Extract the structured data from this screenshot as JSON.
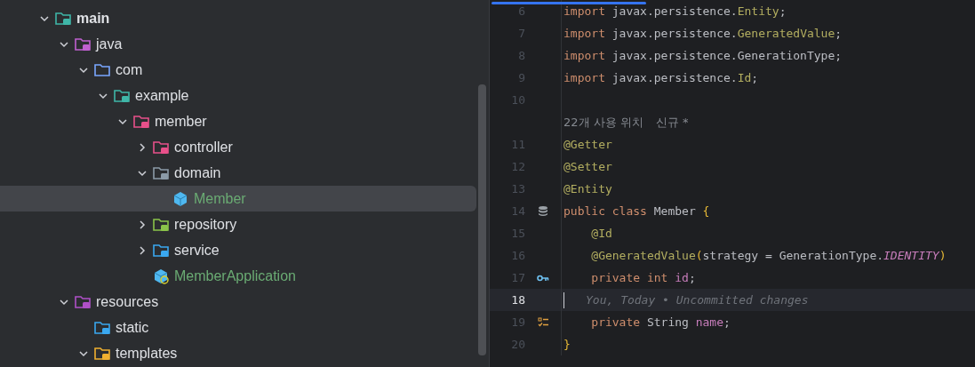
{
  "project_tree": [
    {
      "label": "main",
      "kind": "module",
      "expanded": true,
      "selected": false,
      "color": "#dfe1e5",
      "children": [
        {
          "label": "java",
          "kind": "source",
          "expanded": true,
          "selected": false,
          "color": "#dfe1e5",
          "children": [
            {
              "label": "com",
              "kind": "package",
              "expanded": true,
              "selected": false,
              "color": "#dfe1e5",
              "children": [
                {
                  "label": "example",
                  "kind": "app-package",
                  "expanded": true,
                  "selected": false,
                  "color": "#dfe1e5",
                  "children": [
                    {
                      "label": "member",
                      "kind": "people-package",
                      "expanded": true,
                      "selected": false,
                      "color": "#dfe1e5",
                      "children": [
                        {
                          "label": "controller",
                          "kind": "gear-package",
                          "expanded": false,
                          "selected": false,
                          "color": "#dfe1e5"
                        },
                        {
                          "label": "domain",
                          "kind": "domain-package",
                          "expanded": true,
                          "selected": false,
                          "color": "#dfe1e5",
                          "children": [
                            {
                              "label": "Member",
                              "kind": "class",
                              "selected": true,
                              "color": "#6aab73"
                            }
                          ]
                        },
                        {
                          "label": "repository",
                          "kind": "db-package",
                          "expanded": false,
                          "selected": false,
                          "color": "#dfe1e5"
                        },
                        {
                          "label": "service",
                          "kind": "service-package",
                          "expanded": false,
                          "selected": false,
                          "color": "#dfe1e5"
                        },
                        {
                          "label": "MemberApplication",
                          "kind": "app-class",
                          "selected": false,
                          "color": "#6aab73"
                        }
                      ]
                    }
                  ]
                }
              ]
            }
          ]
        },
        {
          "label": "resources",
          "kind": "resources",
          "expanded": true,
          "selected": false,
          "color": "#dfe1e5",
          "children": [
            {
              "label": "static",
              "kind": "web",
              "selected": false,
              "color": "#dfe1e5"
            },
            {
              "label": "templates",
              "kind": "templates",
              "expanded": true,
              "selected": false,
              "color": "#dfe1e5"
            }
          ]
        }
      ]
    }
  ],
  "editor": {
    "progress": {
      "level": 0.32
    },
    "lines": [
      {
        "kind": "code",
        "number": "6",
        "tokens": [
          {
            "kind": "kw",
            "text": "import "
          },
          {
            "kind": "plain",
            "text": "javax.persistence."
          },
          {
            "kind": "ann",
            "text": "Entity"
          },
          {
            "kind": "plain",
            "text": ";"
          }
        ]
      },
      {
        "kind": "code",
        "number": "7",
        "tokens": [
          {
            "kind": "kw",
            "text": "import "
          },
          {
            "kind": "plain",
            "text": "javax.persistence."
          },
          {
            "kind": "ann",
            "text": "GeneratedValue"
          },
          {
            "kind": "plain",
            "text": ";"
          }
        ]
      },
      {
        "kind": "code",
        "number": "8",
        "tokens": [
          {
            "kind": "kw",
            "text": "import "
          },
          {
            "kind": "plain",
            "text": "javax.persistence.GenerationType;"
          }
        ]
      },
      {
        "kind": "code",
        "number": "9",
        "tokens": [
          {
            "kind": "kw",
            "text": "import "
          },
          {
            "kind": "plain",
            "text": "javax.persistence."
          },
          {
            "kind": "ann",
            "text": "Id"
          },
          {
            "kind": "plain",
            "text": ";"
          }
        ]
      },
      {
        "kind": "code",
        "number": "10"
      },
      {
        "kind": "hint",
        "text": "22개 사용 위치",
        "extra": "신규 *"
      },
      {
        "kind": "code",
        "number": "11",
        "tokens": [
          {
            "kind": "ann",
            "text": "@Getter"
          }
        ]
      },
      {
        "kind": "code",
        "number": "12",
        "tokens": [
          {
            "kind": "ann",
            "text": "@Setter"
          }
        ]
      },
      {
        "kind": "code",
        "number": "13",
        "tokens": [
          {
            "kind": "ann",
            "text": "@Entity"
          }
        ]
      },
      {
        "kind": "code",
        "number": "14",
        "gutter": {
          "kind": "database"
        },
        "tokens": [
          {
            "kind": "kw",
            "text": "public class "
          },
          {
            "kind": "plain",
            "text": "Member "
          },
          {
            "kind": "brace",
            "text": "{"
          }
        ]
      },
      {
        "kind": "code",
        "number": "15",
        "tokens": [
          {
            "kind": "ann",
            "text": "    @Id"
          }
        ]
      },
      {
        "kind": "code",
        "number": "16",
        "tokens": [
          {
            "kind": "ann",
            "text": "    @GeneratedValue"
          },
          {
            "kind": "brace",
            "text": "("
          },
          {
            "kind": "plain",
            "text": "strategy = GenerationType."
          },
          {
            "kind": "const",
            "text": "IDENTITY"
          },
          {
            "kind": "brace",
            "text": ")"
          }
        ]
      },
      {
        "kind": "code",
        "number": "17",
        "gutter": {
          "kind": "key"
        },
        "tokens": [
          {
            "kind": "kw",
            "text": "    private int "
          },
          {
            "kind": "field",
            "text": "id"
          },
          {
            "kind": "plain",
            "text": ";"
          }
        ]
      },
      {
        "kind": "blame",
        "number": "18",
        "current": true,
        "text": "You, Today • Uncommitted changes"
      },
      {
        "kind": "code",
        "number": "19",
        "gutter": {
          "kind": "checklist"
        },
        "tokens": [
          {
            "kind": "kw",
            "text": "    private "
          },
          {
            "kind": "plain",
            "text": "String "
          },
          {
            "kind": "field",
            "text": "name"
          },
          {
            "kind": "plain",
            "text": ";"
          }
        ]
      },
      {
        "kind": "code",
        "number": "20",
        "tokens": [
          {
            "kind": "brace",
            "text": "}"
          }
        ]
      }
    ]
  }
}
